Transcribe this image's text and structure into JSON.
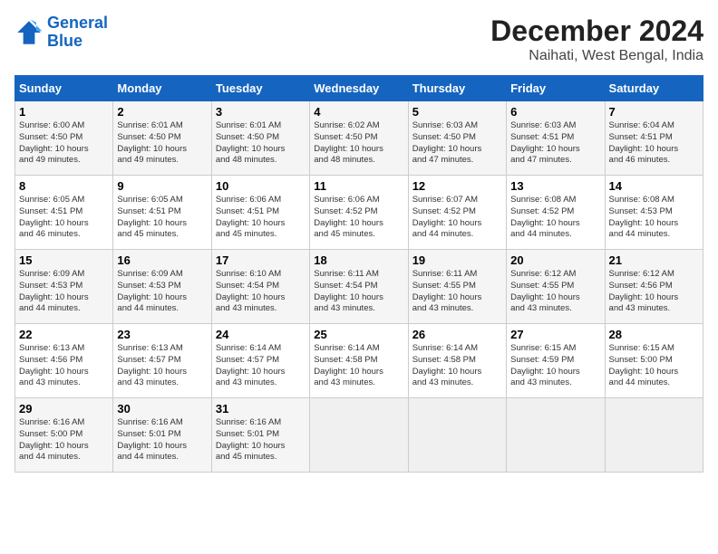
{
  "logo": {
    "line1": "General",
    "line2": "Blue"
  },
  "title": "December 2024",
  "subtitle": "Naihati, West Bengal, India",
  "days_of_week": [
    "Sunday",
    "Monday",
    "Tuesday",
    "Wednesday",
    "Thursday",
    "Friday",
    "Saturday"
  ],
  "weeks": [
    [
      {
        "day": "1",
        "sunrise": "6:00 AM",
        "sunset": "4:50 PM",
        "daylight": "10 hours and 49 minutes."
      },
      {
        "day": "2",
        "sunrise": "6:01 AM",
        "sunset": "4:50 PM",
        "daylight": "10 hours and 49 minutes."
      },
      {
        "day": "3",
        "sunrise": "6:01 AM",
        "sunset": "4:50 PM",
        "daylight": "10 hours and 48 minutes."
      },
      {
        "day": "4",
        "sunrise": "6:02 AM",
        "sunset": "4:50 PM",
        "daylight": "10 hours and 48 minutes."
      },
      {
        "day": "5",
        "sunrise": "6:03 AM",
        "sunset": "4:50 PM",
        "daylight": "10 hours and 47 minutes."
      },
      {
        "day": "6",
        "sunrise": "6:03 AM",
        "sunset": "4:51 PM",
        "daylight": "10 hours and 47 minutes."
      },
      {
        "day": "7",
        "sunrise": "6:04 AM",
        "sunset": "4:51 PM",
        "daylight": "10 hours and 46 minutes."
      }
    ],
    [
      {
        "day": "8",
        "sunrise": "6:05 AM",
        "sunset": "4:51 PM",
        "daylight": "10 hours and 46 minutes."
      },
      {
        "day": "9",
        "sunrise": "6:05 AM",
        "sunset": "4:51 PM",
        "daylight": "10 hours and 45 minutes."
      },
      {
        "day": "10",
        "sunrise": "6:06 AM",
        "sunset": "4:51 PM",
        "daylight": "10 hours and 45 minutes."
      },
      {
        "day": "11",
        "sunrise": "6:06 AM",
        "sunset": "4:52 PM",
        "daylight": "10 hours and 45 minutes."
      },
      {
        "day": "12",
        "sunrise": "6:07 AM",
        "sunset": "4:52 PM",
        "daylight": "10 hours and 44 minutes."
      },
      {
        "day": "13",
        "sunrise": "6:08 AM",
        "sunset": "4:52 PM",
        "daylight": "10 hours and 44 minutes."
      },
      {
        "day": "14",
        "sunrise": "6:08 AM",
        "sunset": "4:53 PM",
        "daylight": "10 hours and 44 minutes."
      }
    ],
    [
      {
        "day": "15",
        "sunrise": "6:09 AM",
        "sunset": "4:53 PM",
        "daylight": "10 hours and 44 minutes."
      },
      {
        "day": "16",
        "sunrise": "6:09 AM",
        "sunset": "4:53 PM",
        "daylight": "10 hours and 44 minutes."
      },
      {
        "day": "17",
        "sunrise": "6:10 AM",
        "sunset": "4:54 PM",
        "daylight": "10 hours and 43 minutes."
      },
      {
        "day": "18",
        "sunrise": "6:11 AM",
        "sunset": "4:54 PM",
        "daylight": "10 hours and 43 minutes."
      },
      {
        "day": "19",
        "sunrise": "6:11 AM",
        "sunset": "4:55 PM",
        "daylight": "10 hours and 43 minutes."
      },
      {
        "day": "20",
        "sunrise": "6:12 AM",
        "sunset": "4:55 PM",
        "daylight": "10 hours and 43 minutes."
      },
      {
        "day": "21",
        "sunrise": "6:12 AM",
        "sunset": "4:56 PM",
        "daylight": "10 hours and 43 minutes."
      }
    ],
    [
      {
        "day": "22",
        "sunrise": "6:13 AM",
        "sunset": "4:56 PM",
        "daylight": "10 hours and 43 minutes."
      },
      {
        "day": "23",
        "sunrise": "6:13 AM",
        "sunset": "4:57 PM",
        "daylight": "10 hours and 43 minutes."
      },
      {
        "day": "24",
        "sunrise": "6:14 AM",
        "sunset": "4:57 PM",
        "daylight": "10 hours and 43 minutes."
      },
      {
        "day": "25",
        "sunrise": "6:14 AM",
        "sunset": "4:58 PM",
        "daylight": "10 hours and 43 minutes."
      },
      {
        "day": "26",
        "sunrise": "6:14 AM",
        "sunset": "4:58 PM",
        "daylight": "10 hours and 43 minutes."
      },
      {
        "day": "27",
        "sunrise": "6:15 AM",
        "sunset": "4:59 PM",
        "daylight": "10 hours and 43 minutes."
      },
      {
        "day": "28",
        "sunrise": "6:15 AM",
        "sunset": "5:00 PM",
        "daylight": "10 hours and 44 minutes."
      }
    ],
    [
      {
        "day": "29",
        "sunrise": "6:16 AM",
        "sunset": "5:00 PM",
        "daylight": "10 hours and 44 minutes."
      },
      {
        "day": "30",
        "sunrise": "6:16 AM",
        "sunset": "5:01 PM",
        "daylight": "10 hours and 44 minutes."
      },
      {
        "day": "31",
        "sunrise": "6:16 AM",
        "sunset": "5:01 PM",
        "daylight": "10 hours and 45 minutes."
      },
      null,
      null,
      null,
      null
    ]
  ],
  "labels": {
    "sunrise": "Sunrise:",
    "sunset": "Sunset:",
    "daylight": "Daylight:"
  }
}
